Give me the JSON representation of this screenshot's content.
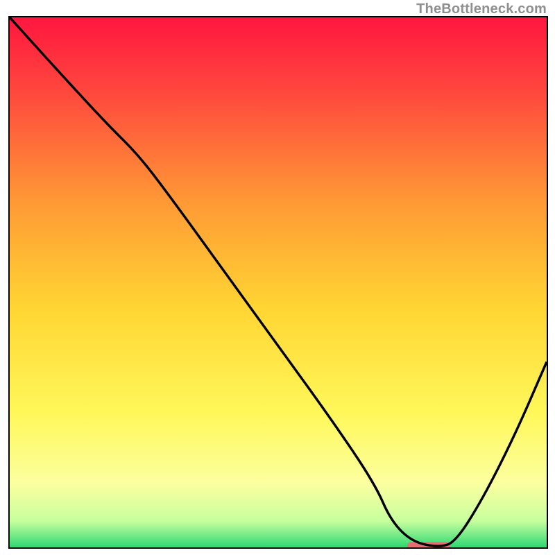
{
  "watermark": "TheBottleneck.com",
  "chart_data": {
    "type": "line",
    "title": "",
    "xlabel": "",
    "ylabel": "",
    "xlim": [
      0,
      100
    ],
    "ylim": [
      0,
      100
    ],
    "grid": false,
    "gradient_stops": [
      {
        "offset": 0.0,
        "color": "#ff163f"
      },
      {
        "offset": 0.15,
        "color": "#ff4b3d"
      },
      {
        "offset": 0.35,
        "color": "#ff9a35"
      },
      {
        "offset": 0.55,
        "color": "#ffd633"
      },
      {
        "offset": 0.75,
        "color": "#fff85b"
      },
      {
        "offset": 0.88,
        "color": "#fbffa0"
      },
      {
        "offset": 0.95,
        "color": "#c8ff9e"
      },
      {
        "offset": 1.0,
        "color": "#2fd873"
      }
    ],
    "series": [
      {
        "name": "bottleneck-curve",
        "type": "line",
        "color": "#000000",
        "x": [
          0,
          8,
          18,
          24,
          30,
          40,
          50,
          60,
          68,
          71,
          75,
          80,
          83,
          88,
          94,
          100
        ],
        "y": [
          100,
          91,
          80,
          74,
          66,
          52,
          38,
          24,
          12,
          5,
          1,
          0,
          1,
          9,
          21,
          35
        ]
      }
    ],
    "marker": {
      "name": "optimal-range",
      "shape": "pill",
      "color": "#e36f74",
      "x_center": 78,
      "y_center": 0,
      "x_half_width": 4,
      "thickness_pct": 1.6
    }
  }
}
